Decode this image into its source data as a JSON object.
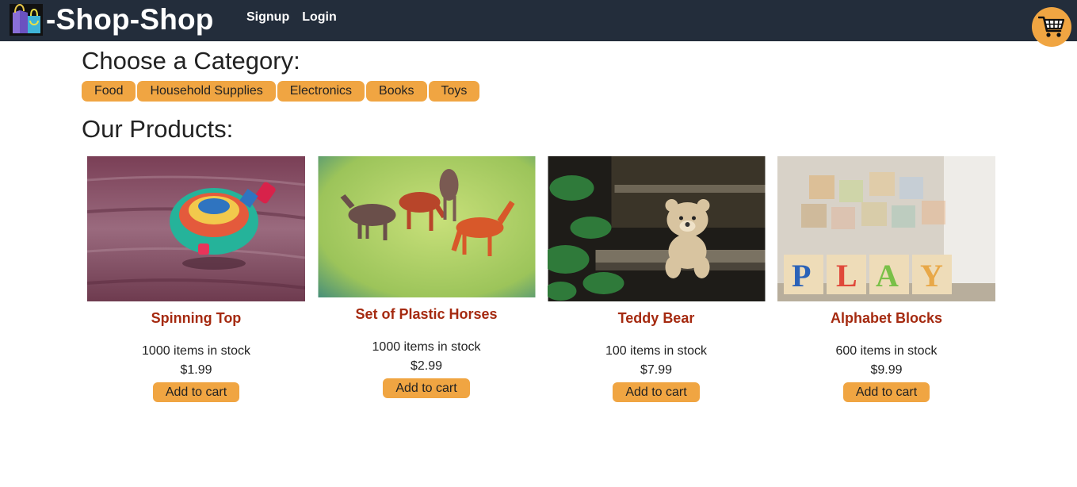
{
  "header": {
    "brand_title": "-Shop-Shop",
    "nav": {
      "signup": "Signup",
      "login": "Login"
    },
    "accent": "#f0a542",
    "background": "#232d3b"
  },
  "categories": {
    "title": "Choose a Category:",
    "items": [
      "Food",
      "Household Supplies",
      "Electronics",
      "Books",
      "Toys"
    ]
  },
  "products": {
    "title": "Our Products:",
    "add_label": "Add to cart",
    "items": [
      {
        "name": "Spinning Top",
        "stock": "1000 items in stock",
        "price": "$1.99",
        "image": "spinning-top-photo"
      },
      {
        "name": "Set of Plastic Horses",
        "stock": "1000 items in stock",
        "price": "$2.99",
        "image": "plastic-horses-photo"
      },
      {
        "name": "Teddy Bear",
        "stock": "100 items in stock",
        "price": "$7.99",
        "image": "teddy-bear-photo"
      },
      {
        "name": "Alphabet Blocks",
        "stock": "600 items in stock",
        "price": "$9.99",
        "image": "alphabet-blocks-photo"
      }
    ]
  },
  "colors": {
    "product_name": "#a52a10",
    "button": "#f0a542"
  },
  "icons": {
    "brand": "shopping-bag-icon",
    "cart": "shopping-cart-icon"
  }
}
